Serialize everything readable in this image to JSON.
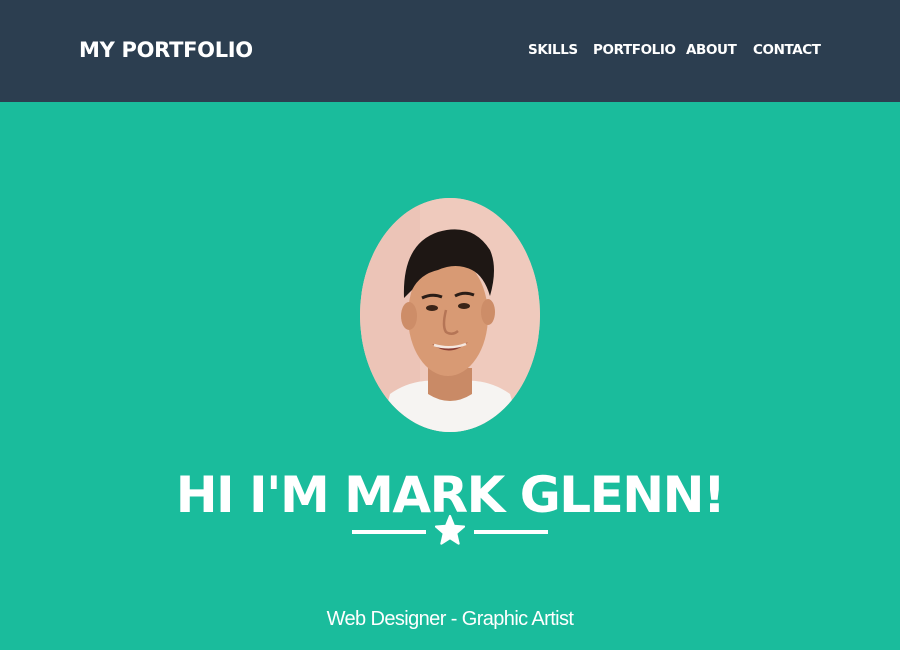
{
  "navbar": {
    "brand": "MY PORTFOLIO",
    "links": [
      {
        "label": "SKILLS"
      },
      {
        "label": "PORTFOLIO"
      },
      {
        "label": "ABOUT"
      },
      {
        "label": "CONTACT"
      }
    ]
  },
  "hero": {
    "title": "HI I'M MARK GLENN!",
    "subtitle": "Web Designer - Graphic Artist",
    "divider_icon": "star-icon"
  },
  "colors": {
    "navbar_bg": "#2c3e50",
    "hero_bg": "#1abc9c",
    "text": "#ffffff"
  }
}
